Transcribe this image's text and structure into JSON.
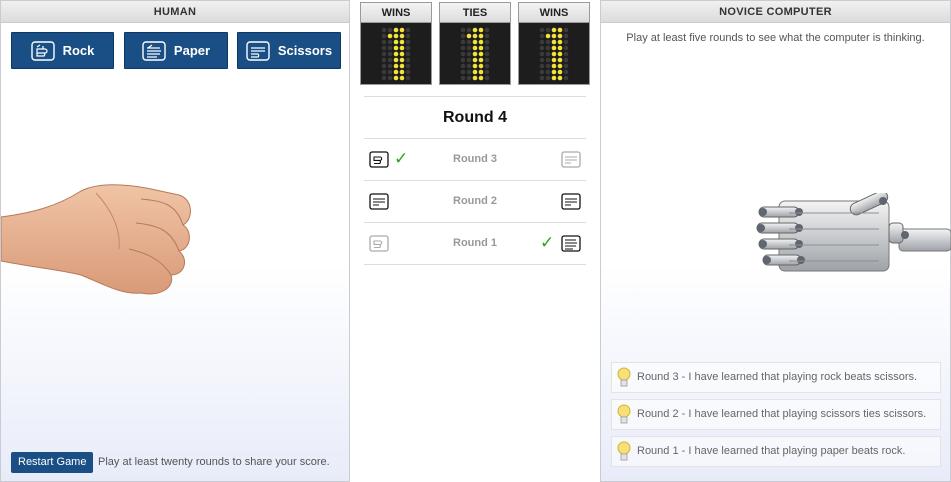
{
  "human": {
    "title": "HUMAN",
    "buttons": {
      "rock": "Rock",
      "paper": "Paper",
      "scissors": "Scissors"
    },
    "restart": "Restart Game",
    "hint": "Play at least twenty rounds to share your score."
  },
  "scoreboard": {
    "wins_label": "WINS",
    "ties_label": "TIES",
    "losses_label": "WINS",
    "human_wins": 1,
    "ties": 1,
    "computer_wins": 1,
    "digit_color": "#f2e23a"
  },
  "rounds": {
    "current": "Round 4",
    "history": [
      {
        "label": "Round 3",
        "human": "rock",
        "computer": "scissors",
        "winner": "human"
      },
      {
        "label": "Round 2",
        "human": "scissors",
        "computer": "scissors",
        "winner": "tie"
      },
      {
        "label": "Round 1",
        "human": "rock",
        "computer": "paper",
        "winner": "computer"
      }
    ]
  },
  "computer": {
    "title": "NOVICE COMPUTER",
    "hint": "Play at least five rounds to see what the computer is thinking.",
    "learned": [
      "Round 3 - I have learned that playing rock beats scissors.",
      "Round 2 - I have learned that playing scissors ties scissors.",
      "Round 1 - I have learned that playing paper beats rock."
    ]
  },
  "colors": {
    "button": "#1a4f86",
    "check": "#2aa51a",
    "bulb": "#f3d23c"
  }
}
